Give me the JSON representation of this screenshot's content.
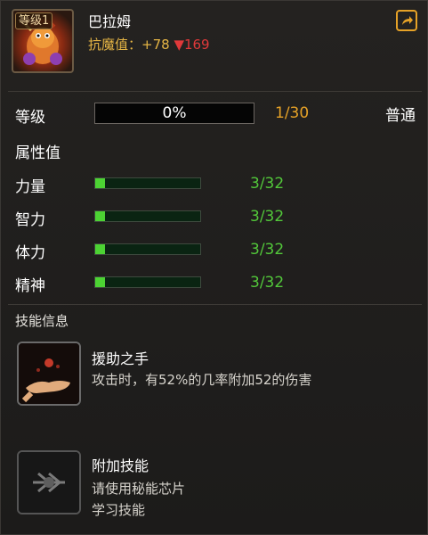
{
  "character": {
    "level_badge": "等级1",
    "name": "巴拉姆",
    "resist_label": "抗魔值：+78",
    "resist_down": "▼169"
  },
  "level_row": {
    "label": "等级",
    "progress_text": "0%",
    "progress": 0,
    "count": "1/30",
    "rarity": "普通"
  },
  "attributes": {
    "title": "属性值",
    "items": [
      {
        "label": "力量",
        "value": "3/32",
        "fill": 0.094
      },
      {
        "label": "智力",
        "value": "3/32",
        "fill": 0.094
      },
      {
        "label": "体力",
        "value": "3/32",
        "fill": 0.094
      },
      {
        "label": "精神",
        "value": "3/32",
        "fill": 0.094
      }
    ]
  },
  "skills": {
    "title": "技能信息",
    "items": [
      {
        "name": "援助之手",
        "desc_line1": "攻击时，有52%的几率附加52的伤害",
        "desc_line2": ""
      },
      {
        "name": "附加技能",
        "desc_line1": "请使用秘能芯片",
        "desc_line2": "学习技能"
      }
    ]
  },
  "colors": {
    "accent_orange": "#e6a227",
    "down_red": "#e0393a",
    "attr_green": "#52c73a"
  }
}
